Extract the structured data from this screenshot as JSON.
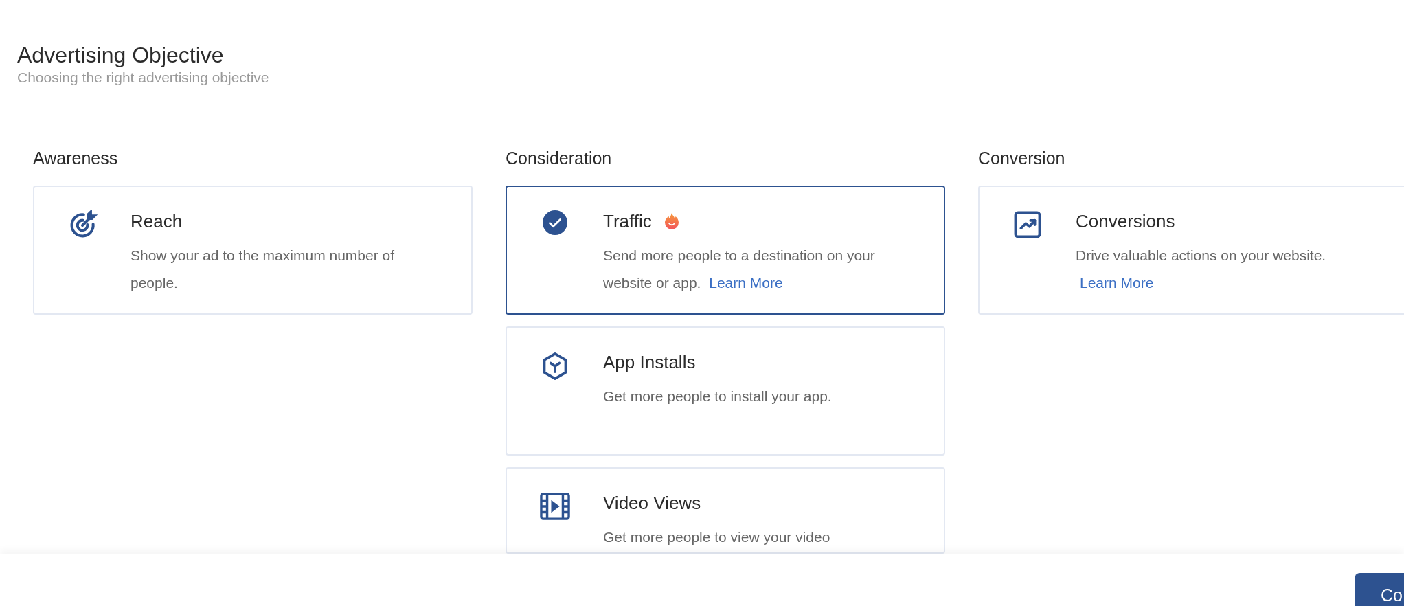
{
  "header": {
    "title": "Advertising Objective",
    "subtitle": "Choosing the right advertising objective"
  },
  "columns": [
    {
      "title": "Awareness",
      "objectives": [
        {
          "kind": "reach",
          "title": "Reach",
          "description": "Show your ad to the maximum number of people.",
          "selected": false
        }
      ]
    },
    {
      "title": "Consideration",
      "objectives": [
        {
          "title": "Traffic",
          "description": "Send more people to a destination on your website or app.",
          "link": "Learn More",
          "selected": true,
          "hot": true
        },
        {
          "kind": "app_installs",
          "title": "App Installs",
          "description": "Get more people to install your app.",
          "selected": false
        },
        {
          "kind": "video_views",
          "title": "Video Views",
          "description": "Get more people to view your video",
          "selected": false
        }
      ]
    },
    {
      "title": "Conversion",
      "objectives": [
        {
          "kind": "conversions",
          "title": "Conversions",
          "description": "Drive valuable actions on your website.",
          "link": "Learn More",
          "selected": false
        }
      ]
    }
  ],
  "footer": {
    "button": "Co"
  }
}
